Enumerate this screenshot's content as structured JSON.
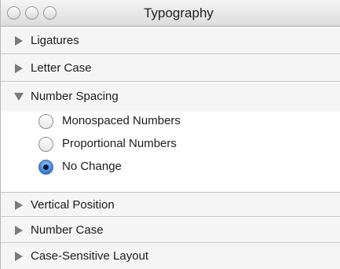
{
  "window": {
    "title": "Typography"
  },
  "sections": {
    "ligatures": {
      "label": "Ligatures",
      "expanded": false
    },
    "letter_case": {
      "label": "Letter Case",
      "expanded": false
    },
    "number_spacing": {
      "label": "Number Spacing",
      "expanded": true,
      "options": [
        {
          "label": "Monospaced Numbers",
          "selected": false
        },
        {
          "label": "Proportional Numbers",
          "selected": false
        },
        {
          "label": "No Change",
          "selected": true
        }
      ]
    },
    "vertical_position": {
      "label": "Vertical Position",
      "expanded": false
    },
    "number_case": {
      "label": "Number Case",
      "expanded": false
    },
    "case_sensitive_layout": {
      "label": "Case-Sensitive Layout",
      "expanded": false
    }
  },
  "colors": {
    "selected_radio": "#3f86d8",
    "section_background": "#f5f5f5",
    "divider": "#c4c4c4"
  },
  "icons": {
    "collapsed": "disclosure-triangle-right-icon",
    "expanded": "disclosure-triangle-down-icon",
    "window_controls": [
      "close-button",
      "minimize-button",
      "zoom-button"
    ]
  }
}
